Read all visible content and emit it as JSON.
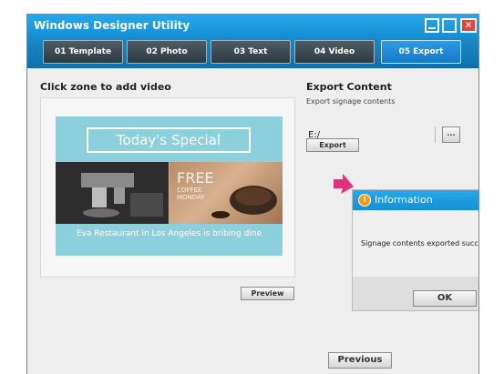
{
  "window": {
    "title": "Windows Designer Utility"
  },
  "tabs": [
    {
      "label": "01 Template"
    },
    {
      "label": "02 Photo"
    },
    {
      "label": "03 Text"
    },
    {
      "label": "04 Video"
    },
    {
      "label": "05 Export",
      "active": true
    }
  ],
  "video_zone": {
    "label": "Click zone to add video",
    "signage": {
      "heading": "Today's Special",
      "promo_title": "FREE",
      "promo_sub": "COFFEE\nMONDAY",
      "caption": "Eva Restaurant in Los Angeles is bribing dine"
    },
    "preview_label": "Preview"
  },
  "export": {
    "title": "Export Content",
    "subtitle": "Export signage contents",
    "path": "E:/",
    "browse_label": "...",
    "button_label": "Export"
  },
  "dialog": {
    "title": "Information",
    "icon": "info-icon",
    "message": "Signage contents exported success",
    "ok_label": "OK"
  },
  "footer": {
    "previous_label": "Previous"
  },
  "colors": {
    "titlebar": "#148fd4",
    "active_tab": "#1579c6",
    "tab": "#3a4750",
    "signage_bg": "#8bd0dc",
    "arrow": "#e2307a",
    "info": "#f39a1b"
  }
}
